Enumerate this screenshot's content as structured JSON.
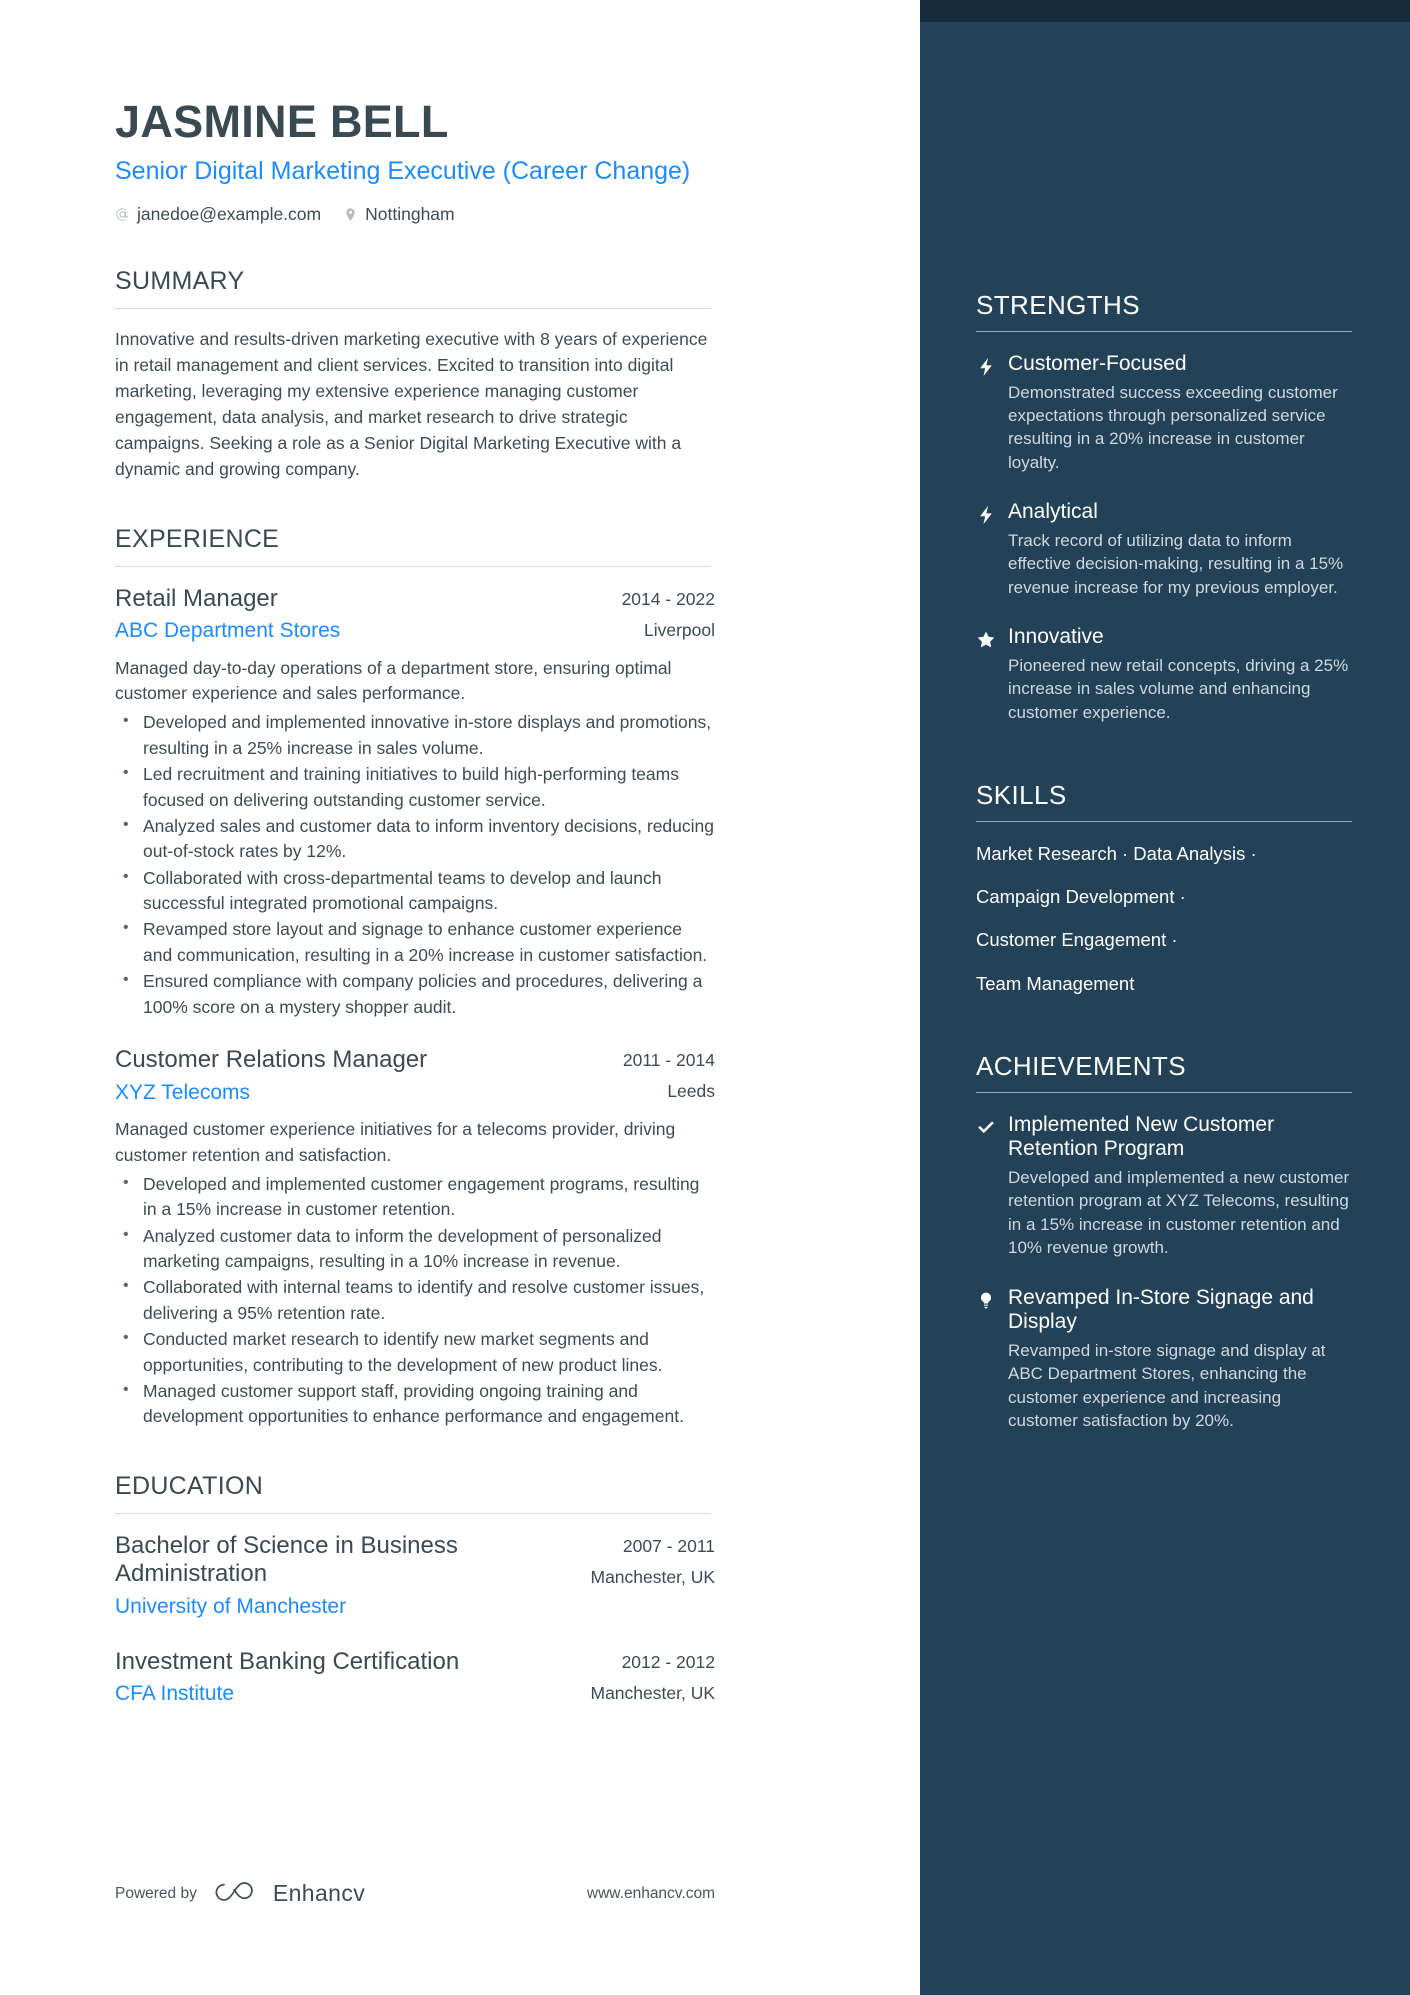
{
  "header": {
    "name": "JASMINE BELL",
    "role": "Senior Digital Marketing Executive (Career Change)",
    "email": "janedoe@example.com",
    "location": "Nottingham"
  },
  "colors": {
    "accent_blue": "#1a8cff",
    "sidebar_bg": "#234157",
    "sidebar_top_strip": "#152b3d",
    "text_dark": "#3e4b55"
  },
  "summary": {
    "title": "SUMMARY",
    "text": "Innovative and results-driven marketing executive with 8 years of experience in retail management and client services. Excited to transition into digital marketing, leveraging my extensive experience managing customer engagement, data analysis, and market research to drive strategic campaigns. Seeking a role as a Senior Digital Marketing Executive with a dynamic and growing company."
  },
  "experience": {
    "title": "EXPERIENCE",
    "entries": [
      {
        "job_title": "Retail Manager",
        "company": "ABC Department Stores",
        "dates": "2014 - 2022",
        "location": "Liverpool",
        "description": "Managed day-to-day operations of a department store, ensuring optimal customer experience and sales performance.",
        "bullets": [
          "Developed and implemented innovative in-store displays and promotions, resulting in a 25% increase in sales volume.",
          "Led recruitment and training initiatives to build high-performing teams focused on delivering outstanding customer service.",
          "Analyzed sales and customer data to inform inventory decisions, reducing out-of-stock rates by 12%.",
          "Collaborated with cross-departmental teams to develop and launch successful integrated promotional campaigns.",
          "Revamped store layout and signage to enhance customer experience and communication, resulting in a 20% increase in customer satisfaction.",
          "Ensured compliance with company policies and procedures, delivering a 100% score on a mystery shopper audit."
        ]
      },
      {
        "job_title": "Customer Relations Manager",
        "company": "XYZ Telecoms",
        "dates": "2011 - 2014",
        "location": "Leeds",
        "description": "Managed customer experience initiatives for a telecoms provider, driving customer retention and satisfaction.",
        "bullets": [
          "Developed and implemented customer engagement programs, resulting in a 15% increase in customer retention.",
          "Analyzed customer data to inform the development of personalized marketing campaigns, resulting in a 10% increase in revenue.",
          "Collaborated with internal teams to identify and resolve customer issues, delivering a 95% retention rate.",
          "Conducted market research to identify new market segments and opportunities, contributing to the development of new product lines.",
          "Managed customer support staff, providing ongoing training and development opportunities to enhance performance and engagement."
        ]
      }
    ]
  },
  "education": {
    "title": "EDUCATION",
    "entries": [
      {
        "degree": "Bachelor of Science in Business Administration",
        "school": "University of Manchester",
        "dates": "2007 - 2011",
        "location": "Manchester, UK"
      },
      {
        "degree": "Investment Banking Certification",
        "school": "CFA Institute",
        "dates": "2012 - 2012",
        "location": "Manchester, UK"
      }
    ]
  },
  "strengths": {
    "title": "STRENGTHS",
    "items": [
      {
        "icon": "lightning-bolt-icon",
        "title": "Customer-Focused",
        "description": "Demonstrated success exceeding customer expectations through personalized service resulting in a 20% increase in customer loyalty."
      },
      {
        "icon": "lightning-bolt-icon",
        "title": "Analytical",
        "description": "Track record of utilizing data to inform effective decision-making, resulting in a 15% revenue increase for my previous employer."
      },
      {
        "icon": "star-icon",
        "title": "Innovative",
        "description": "Pioneered new retail concepts, driving a 25% increase in sales volume and enhancing customer experience."
      }
    ]
  },
  "skills": {
    "title": "SKILLS",
    "lines": [
      "Market Research · Data Analysis ·",
      "Campaign Development ·",
      "Customer Engagement ·",
      "Team Management"
    ]
  },
  "achievements": {
    "title": "ACHIEVEMENTS",
    "items": [
      {
        "icon": "check-icon",
        "title": "Implemented New Customer Retention Program",
        "description": "Developed and implemented a new customer retention program at XYZ Telecoms, resulting in a 15% increase in customer retention and 10% revenue growth."
      },
      {
        "icon": "lightbulb-icon",
        "title": "Revamped In-Store Signage and Display",
        "description": "Revamped in-store signage and display at ABC Department Stores, enhancing the customer experience and increasing customer satisfaction by 20%."
      }
    ]
  },
  "footer": {
    "powered_by": "Powered by",
    "brand": "Enhancv",
    "website": "www.enhancv.com"
  }
}
